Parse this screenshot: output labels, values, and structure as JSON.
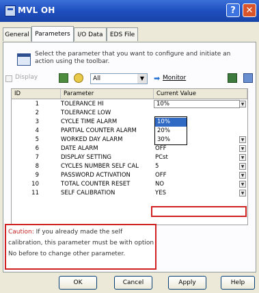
{
  "window": {
    "title": "MVL OH"
  },
  "tabs": [
    {
      "label": "General"
    },
    {
      "label": "Parameters"
    },
    {
      "label": "I/O Data"
    },
    {
      "label": "EDS File"
    }
  ],
  "hint": "Select the parameter that you want to configure and initiate an action using the toolbar.",
  "toolbar": {
    "display_label": "Display",
    "display_checked": false,
    "filter_value": "All",
    "monitor_label": "Monitor"
  },
  "table": {
    "headers": {
      "id": "ID",
      "parameter": "Parameter",
      "value": "Current Value"
    },
    "rows": [
      {
        "id": "1",
        "parameter": "TOLERANCE HI",
        "value": "10%"
      },
      {
        "id": "2",
        "parameter": "TOLERANCE LOW",
        "value": ""
      },
      {
        "id": "3",
        "parameter": "CYCLE TIME ALARM",
        "value": ""
      },
      {
        "id": "4",
        "parameter": "PARTIAL COUNTER ALARM",
        "value": ""
      },
      {
        "id": "5",
        "parameter": "WORKED DAY ALARM",
        "value": "OFF"
      },
      {
        "id": "6",
        "parameter": "DATE ALARM",
        "value": "OFF"
      },
      {
        "id": "7",
        "parameter": "DISPLAY SETTING",
        "value": "PCst"
      },
      {
        "id": "8",
        "parameter": "CYCLES NUMBER SELF CAL",
        "value": "5"
      },
      {
        "id": "9",
        "parameter": "PASSWORD ACTIVATION",
        "value": "OFF"
      },
      {
        "id": "10",
        "parameter": "TOTAL COUNTER RESET",
        "value": "NO"
      },
      {
        "id": "11",
        "parameter": "SELF CALIBRATION",
        "value": "YES"
      }
    ],
    "dropdown_options": [
      {
        "label": "10%",
        "selected": true
      },
      {
        "label": "20%",
        "selected": false
      },
      {
        "label": "30%",
        "selected": false
      }
    ]
  },
  "caution": {
    "label": "Caution:",
    "text": " If you already made the self calibration, this parameter must be with option No before to change other parameter."
  },
  "buttons": {
    "ok": "OK",
    "cancel": "Cancel",
    "apply": "Apply",
    "help": "Help"
  },
  "colors": {
    "titlebar": "#1f4fbf",
    "highlight": "#d02020",
    "selection": "#316ac5"
  }
}
